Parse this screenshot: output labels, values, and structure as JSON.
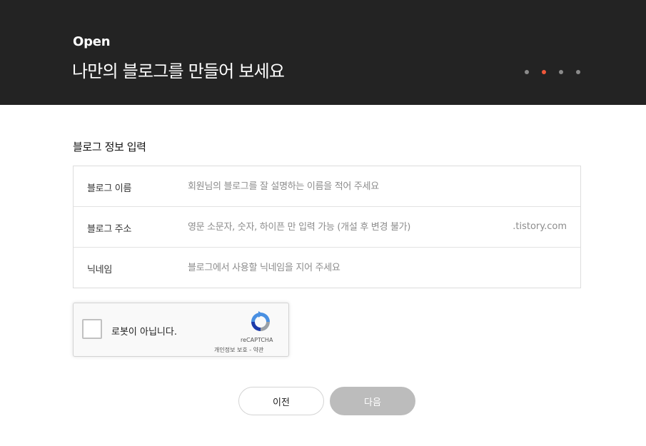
{
  "hero": {
    "kicker": "Open",
    "title": "나만의 블로그를 만들어 보세요",
    "steps": [
      {
        "active": false
      },
      {
        "active": true
      },
      {
        "active": false
      },
      {
        "active": false
      }
    ],
    "colors": {
      "background": "#232323",
      "step_active": "#f0573a",
      "step_inactive": "#8a8a8a"
    }
  },
  "section": {
    "title": "블로그 정보 입력"
  },
  "form": {
    "blog_name": {
      "label": "블로그 이름",
      "placeholder": "회원님의 블로그를 잘 설명하는 이름을 적어 주세요",
      "value": ""
    },
    "blog_address": {
      "label": "블로그 주소",
      "placeholder": "영문 소문자, 숫자, 하이픈 만 입력 가능 (개설 후 변경 불가)",
      "value": "",
      "suffix": ".tistory.com"
    },
    "nickname": {
      "label": "닉네임",
      "placeholder": "블로그에서 사용할 닉네임을 지어 주세요",
      "value": ""
    }
  },
  "captcha": {
    "label": "로봇이 아닙니다.",
    "brand": "reCAPTCHA",
    "links": "개인정보 보호 - 약관",
    "checked": false,
    "icon": "recaptcha-logo-icon"
  },
  "buttons": {
    "prev": "이전",
    "next": "다음",
    "next_enabled": false
  }
}
